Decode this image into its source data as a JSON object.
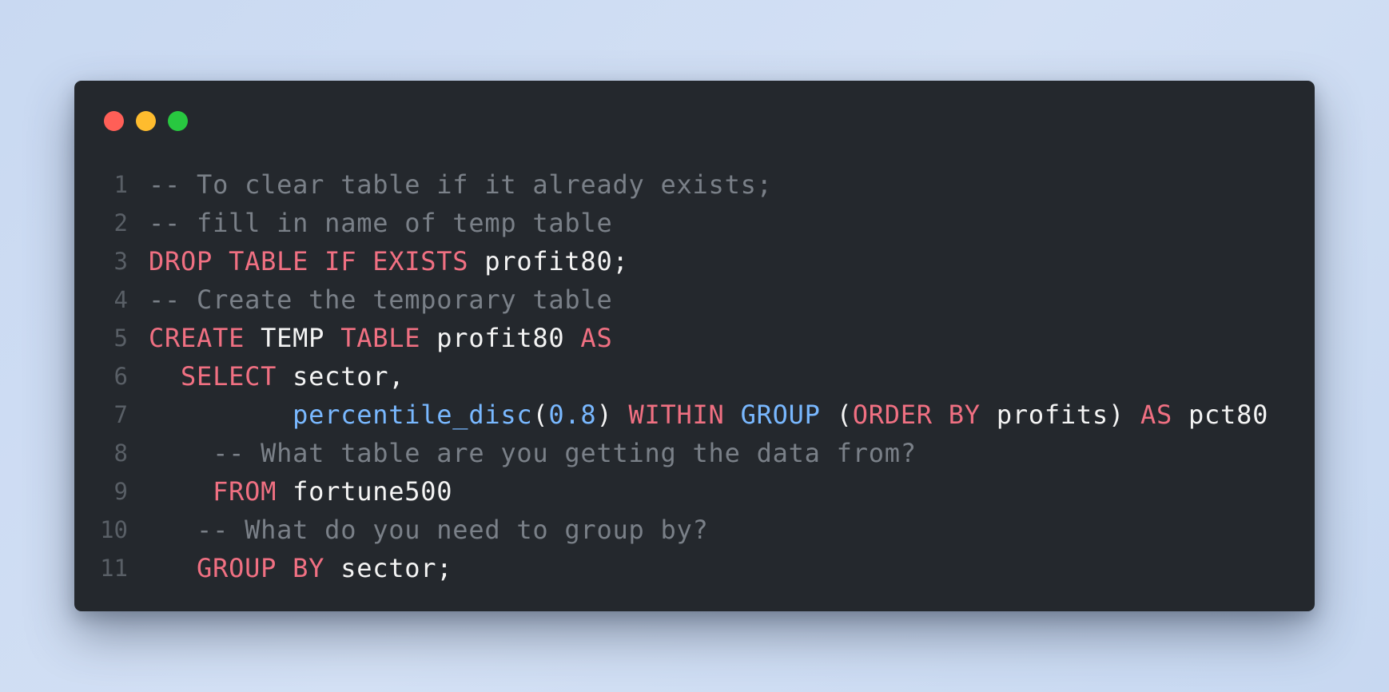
{
  "window": {
    "controls": [
      {
        "name": "close",
        "color": "#ff5f57"
      },
      {
        "name": "minimize",
        "color": "#febc2e"
      },
      {
        "name": "maximize",
        "color": "#28c840"
      }
    ]
  },
  "editor": {
    "language": "sql",
    "lines": [
      {
        "num": "1",
        "tokens": [
          {
            "t": "comment",
            "v": "-- To clear table if it already exists;"
          }
        ]
      },
      {
        "num": "2",
        "tokens": [
          {
            "t": "comment",
            "v": "-- fill in name of temp table"
          }
        ]
      },
      {
        "num": "3",
        "tokens": [
          {
            "t": "keyword",
            "v": "DROP"
          },
          {
            "t": "plain",
            "v": " "
          },
          {
            "t": "keyword",
            "v": "TABLE"
          },
          {
            "t": "plain",
            "v": " "
          },
          {
            "t": "keyword",
            "v": "IF"
          },
          {
            "t": "plain",
            "v": " "
          },
          {
            "t": "keyword",
            "v": "EXISTS"
          },
          {
            "t": "plain",
            "v": " profit80;"
          }
        ]
      },
      {
        "num": "4",
        "tokens": [
          {
            "t": "comment",
            "v": "-- Create the temporary table"
          }
        ]
      },
      {
        "num": "5",
        "tokens": [
          {
            "t": "keyword",
            "v": "CREATE"
          },
          {
            "t": "plain",
            "v": " TEMP "
          },
          {
            "t": "keyword",
            "v": "TABLE"
          },
          {
            "t": "plain",
            "v": " profit80 "
          },
          {
            "t": "keyword",
            "v": "AS"
          }
        ]
      },
      {
        "num": "6",
        "tokens": [
          {
            "t": "plain",
            "v": "  "
          },
          {
            "t": "keyword",
            "v": "SELECT"
          },
          {
            "t": "plain",
            "v": " sector,"
          }
        ]
      },
      {
        "num": "7",
        "tokens": [
          {
            "t": "plain",
            "v": "         "
          },
          {
            "t": "func",
            "v": "percentile_disc"
          },
          {
            "t": "plain",
            "v": "("
          },
          {
            "t": "number",
            "v": "0.8"
          },
          {
            "t": "plain",
            "v": ") "
          },
          {
            "t": "keyword",
            "v": "WITHIN"
          },
          {
            "t": "plain",
            "v": " "
          },
          {
            "t": "func",
            "v": "GROUP"
          },
          {
            "t": "plain",
            "v": " ("
          },
          {
            "t": "keyword",
            "v": "ORDER"
          },
          {
            "t": "plain",
            "v": " "
          },
          {
            "t": "keyword",
            "v": "BY"
          },
          {
            "t": "plain",
            "v": " profits) "
          },
          {
            "t": "keyword",
            "v": "AS"
          },
          {
            "t": "plain",
            "v": " pct80"
          }
        ]
      },
      {
        "num": "8",
        "tokens": [
          {
            "t": "plain",
            "v": "    "
          },
          {
            "t": "comment",
            "v": "-- What table are you getting the data from?"
          }
        ]
      },
      {
        "num": "9",
        "tokens": [
          {
            "t": "plain",
            "v": "    "
          },
          {
            "t": "keyword",
            "v": "FROM"
          },
          {
            "t": "plain",
            "v": " fortune500"
          }
        ]
      },
      {
        "num": "10",
        "tokens": [
          {
            "t": "plain",
            "v": "   "
          },
          {
            "t": "comment",
            "v": "-- What do you need to group by?"
          }
        ]
      },
      {
        "num": "11",
        "tokens": [
          {
            "t": "plain",
            "v": "   "
          },
          {
            "t": "keyword",
            "v": "GROUP"
          },
          {
            "t": "plain",
            "v": " "
          },
          {
            "t": "keyword",
            "v": "BY"
          },
          {
            "t": "plain",
            "v": " sector;"
          }
        ]
      }
    ]
  }
}
